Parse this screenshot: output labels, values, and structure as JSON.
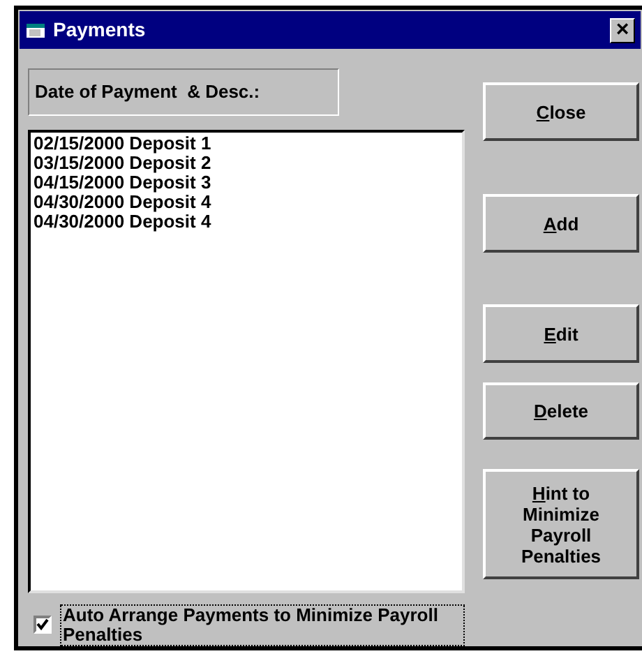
{
  "window": {
    "title": "Payments",
    "close_glyph": "×"
  },
  "list_header": "Date of Payment  & Desc.:",
  "payments": [
    {
      "text": "02/15/2000 Deposit 1",
      "selected": false
    },
    {
      "text": "03/15/2000 Deposit 2",
      "selected": false
    },
    {
      "text": "04/15/2000 Deposit 3",
      "selected": false
    },
    {
      "text": "04/30/2000 Deposit 4",
      "selected": false
    },
    {
      "text": "04/30/2000 Deposit 4",
      "selected": false
    }
  ],
  "buttons": [
    {
      "accel": "C",
      "rest": "lose"
    },
    {
      "accel": "A",
      "rest": "dd"
    },
    {
      "accel": "E",
      "rest": "dit"
    },
    {
      "accel": "D",
      "rest": "elete"
    },
    {
      "accel": "H",
      "rest": "int to Minimize Payroll Penalties"
    }
  ],
  "auto_arrange": {
    "label": "Auto Arrange Payments to Minimize Payroll Penalties",
    "checked": true
  }
}
